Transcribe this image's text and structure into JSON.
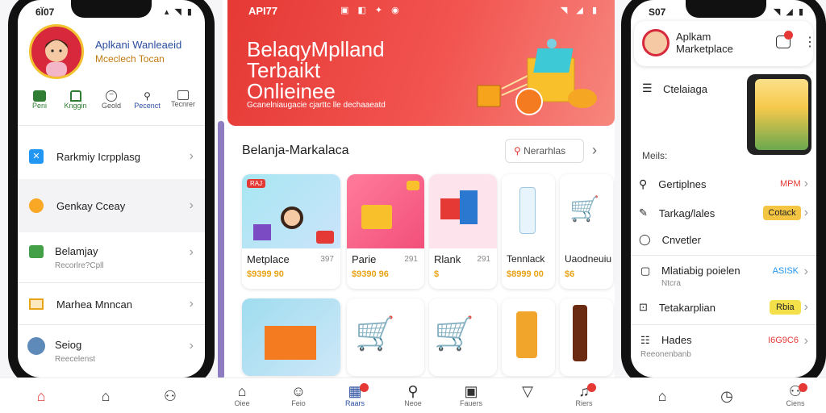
{
  "left_phone": {
    "status_time": "6Ï07",
    "status_icons": "▴ ◥ ▮",
    "profile": {
      "title": "Aplkani Wanleaeid",
      "subtitle": "Mceclech Tocan"
    },
    "quick_actions": [
      {
        "label": "Peni",
        "icon": "wallet-icon"
      },
      {
        "label": "Knggin",
        "icon": "bookmark-icon"
      },
      {
        "label": "Geold",
        "icon": "minus-circle-icon"
      },
      {
        "label": "Pecenct",
        "icon": "person-icon"
      },
      {
        "label": "Tecnrer",
        "icon": "chat-box-icon"
      }
    ],
    "menu": [
      {
        "label": "Rarkmiy Icrpplasg",
        "sub": "",
        "icon": "cart-icon",
        "color": "#2196f3"
      },
      {
        "label": "Genkay Cceay",
        "sub": "",
        "icon": "box-icon",
        "color": "#f9a825"
      },
      {
        "label": "Belamjay",
        "sub": "Recorlre?Cpll",
        "icon": "grid-icon",
        "color": "#43a047"
      },
      {
        "label": "Marhea Mnncan",
        "sub": "",
        "icon": "card-icon",
        "color": "#e8a317"
      },
      {
        "label": "Seiog",
        "sub": "Reecelenst",
        "icon": "avatar-icon",
        "color": "#5d8ab8"
      }
    ]
  },
  "center": {
    "status_time": "API77",
    "status_icons_left": "▣ ◧ ✦ ◉",
    "status_icons_right": "◥ ◢ ▮",
    "hero": {
      "title_line1": "BelaqyMplland",
      "title_line2": "Terbaikt",
      "title_line3": "Onlieinee",
      "subtitle": "Gcanelniaugacie cjarttc lle dechaaeatd"
    },
    "section_title": "Belanja-Markalaca",
    "section_button": "Nerarhlas",
    "products_row1": [
      {
        "name": "Metplace",
        "code": "397",
        "price": "$9399 90",
        "tag": "RAJ"
      },
      {
        "name": "Parie",
        "code": "291",
        "price": "$9390 96",
        "tag": ""
      },
      {
        "name": "Rlank",
        "code": "291",
        "price": "$",
        "tag": ""
      },
      {
        "name": "Tennlack",
        "code": "",
        "price": "$8999 00",
        "tag": ""
      },
      {
        "name": "Uaodneuiu",
        "code": "",
        "price": "$6",
        "tag": ""
      }
    ],
    "bottom_nav": [
      {
        "label": "Oiee",
        "icon": "home-icon"
      },
      {
        "label": "Feio",
        "icon": "face-icon"
      },
      {
        "label": "Raars",
        "icon": "store-icon"
      },
      {
        "label": "Neoe",
        "icon": "search-icon"
      },
      {
        "label": "Fauers",
        "icon": "image-icon"
      },
      {
        "label": "",
        "icon": "bag-icon"
      },
      {
        "label": "Riers",
        "icon": "bell-icon"
      }
    ]
  },
  "right_phone": {
    "status_time": "S07",
    "status_icons": "◥ ◢ ▮",
    "header": {
      "title_line1": "Aplkam",
      "title_line2": "Marketplace"
    },
    "menu_title": "Ctelaiaga",
    "section_label": "Meils:",
    "menu": [
      {
        "label": "Gertiplnes",
        "sub": "",
        "value": "MPM",
        "value_style": "red",
        "icon": "search-icon"
      },
      {
        "label": "Tarkag/lales",
        "sub": "",
        "value": "Cotack",
        "value_style": "pill",
        "icon": "edit-icon"
      },
      {
        "label": "Cnvetler",
        "sub": "",
        "value": "",
        "value_style": "",
        "icon": "chat-icon"
      },
      {
        "label": "Mlatiabig poielen",
        "sub": "Ntcra",
        "value": "ASISK",
        "value_style": "blue",
        "icon": "doc-icon"
      },
      {
        "label": "Tetakarplian",
        "sub": "",
        "value": "Rbia",
        "value_style": "pill",
        "icon": "tag-icon"
      },
      {
        "label": "Hades",
        "sub": "Reeonenbanb",
        "value": "I6G9C6",
        "value_style": "red",
        "icon": "list-icon"
      }
    ]
  },
  "bottom_bar": {
    "items": [
      {
        "label": "",
        "icon": "home-icon"
      },
      {
        "label": "",
        "icon": "home-outline-icon"
      },
      {
        "label": "",
        "icon": "person-icon"
      },
      {
        "label": "",
        "icon": "home-outline-icon"
      },
      {
        "label": "",
        "icon": "clock-icon"
      },
      {
        "label": "Ciens",
        "icon": "person-icon"
      }
    ]
  },
  "colors": {
    "accent": "#e53935",
    "gold": "#f4c542",
    "hero_start": "#e53935",
    "hero_end": "#f4716a"
  }
}
